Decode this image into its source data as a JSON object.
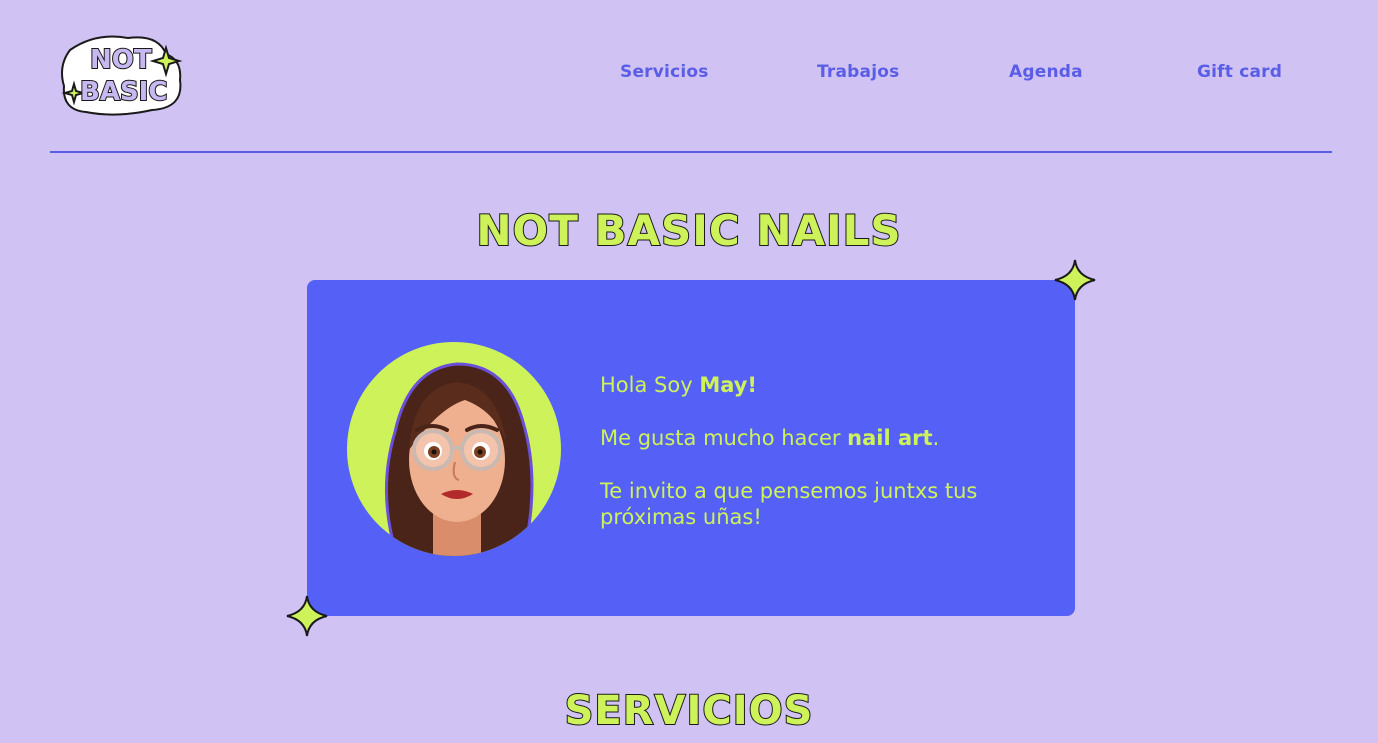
{
  "header": {
    "logo_lines": [
      "NOT",
      "BASIC"
    ],
    "nav": [
      {
        "label": "Servicios"
      },
      {
        "label": "Trabajos"
      },
      {
        "label": "Agenda"
      },
      {
        "label": "Gift card"
      }
    ]
  },
  "hero": {
    "title": "NOT BASIC NAILS",
    "intro_prefix": "Hola Soy ",
    "intro_name": "May!",
    "line2_prefix": "Me gusta mucho hacer ",
    "line2_bold": "nail art",
    "line2_suffix": ".",
    "line3": "Te invito a que pensemos juntxs tus próximas uñas!"
  },
  "services": {
    "title": "SERVICIOS"
  },
  "colors": {
    "background": "#d1c2f4",
    "accent": "#5a5ee6",
    "card": "#5560f7",
    "lime": "#cdf25a"
  },
  "icons": {
    "sparkle": "sparkle-icon",
    "avatar": "avatar-illustration"
  }
}
